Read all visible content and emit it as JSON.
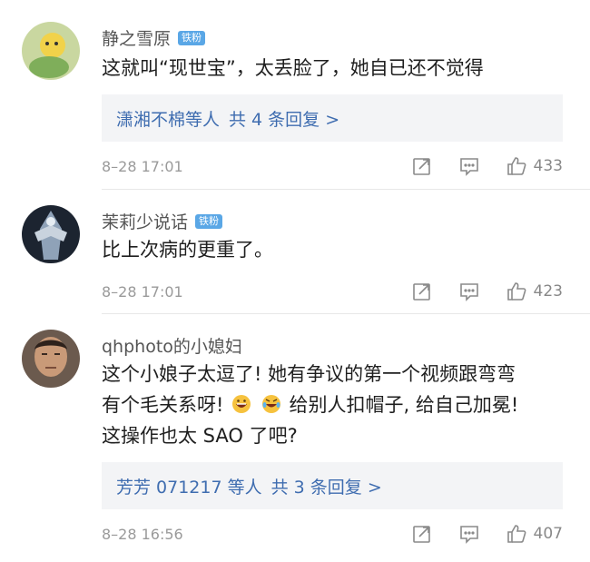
{
  "comments": [
    {
      "username": "静之雪原",
      "badge": "铁粉",
      "lines": [
        "这就叫“现世宝”，太丢脸了，她自已还不觉得"
      ],
      "reply_summary": {
        "names": "潇湘不棉等人",
        "count": "共 4 条回复 >"
      },
      "time": "8–28 17:01",
      "likes": "433"
    },
    {
      "username": "茉莉少说话",
      "badge": "铁粉",
      "lines": [
        "比上次病的更重了。"
      ],
      "time": "8–28 17:01",
      "likes": "423"
    },
    {
      "username": "qhphoto的小媳妇",
      "lines": [
        "这个小娘子太逗了! 她有争议的第一个视频跟弯弯",
        "给别人扣帽子, 给自己加冕!",
        "这操作也太 SAO 了吧?"
      ],
      "line2_prefix": "有个毛关系呀!",
      "reply_summary": {
        "names": "芳芳 071217 等人",
        "count": "共 3 条回复 >"
      },
      "time": "8–28 16:56",
      "likes": "407"
    }
  ],
  "colors": {
    "badge": "#5aa7e6",
    "link": "#3f6db0",
    "reply_bg": "#f3f4f6"
  }
}
